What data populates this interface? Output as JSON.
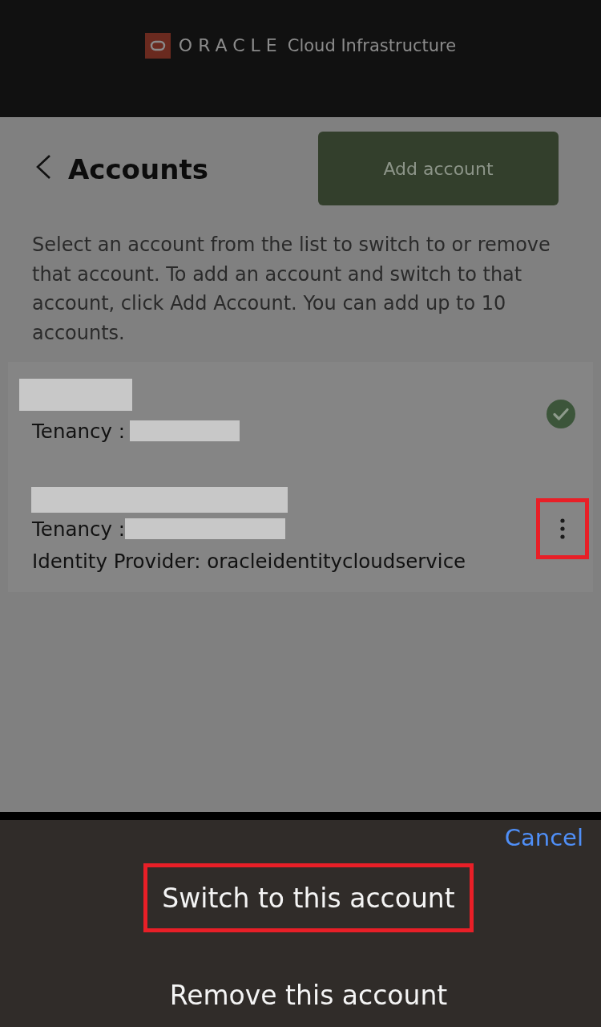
{
  "header": {
    "brand": "ORACLE",
    "product": "Cloud Infrastructure"
  },
  "page": {
    "title": "Accounts",
    "add_button": "Add account",
    "description": "Select an account from the list to switch to or remove that account. To add an account and switch to that account, click Add Account. You can add up to 10 accounts."
  },
  "accounts": [
    {
      "selected": true,
      "name_redacted": true,
      "tenancy_label": "Tenancy :",
      "tenancy_redacted": true
    },
    {
      "selected": false,
      "name_redacted": true,
      "tenancy_label": "Tenancy :",
      "tenancy_redacted": true,
      "identity_provider": "Identity Provider: oracleidentitycloudservice",
      "menu_highlighted": true
    }
  ],
  "action_sheet": {
    "cancel": "Cancel",
    "actions": [
      {
        "label": "Switch to this account",
        "highlighted": true
      },
      {
        "label": "Remove this account",
        "highlighted": false
      }
    ]
  }
}
